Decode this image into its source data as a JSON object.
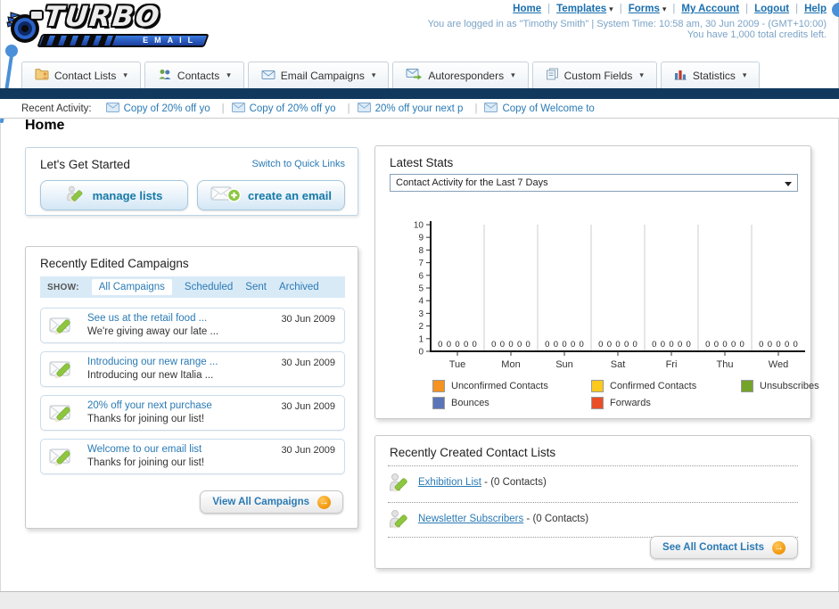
{
  "colors": {
    "accent_link": "#2A7AB5",
    "navy_bar": "#11395E",
    "annotation_dot": "#4A90D9",
    "button_text": "#1779A8",
    "filter_bar_bg": "#D9EAF7"
  },
  "logo": {
    "title": "TURBO",
    "subtitle": "EMAIL"
  },
  "header": {
    "links": [
      {
        "label": "Home",
        "has_dropdown": false
      },
      {
        "label": "Templates",
        "has_dropdown": true
      },
      {
        "label": "Forms",
        "has_dropdown": true
      },
      {
        "label": "My Account",
        "has_dropdown": false
      },
      {
        "label": "Logout",
        "has_dropdown": false
      },
      {
        "label": "Help",
        "has_dropdown": false
      }
    ],
    "login_line": "You are logged in as \"Timothy Smith\" | System Time: 10:58 am, 30 Jun 2009 - (GMT+10:00)",
    "credits_line": "You have 1,000 total credits left."
  },
  "nav": {
    "tabs": [
      {
        "label": "Contact Lists",
        "icon": "folder-contact-icon"
      },
      {
        "label": "Contacts",
        "icon": "contacts-icon"
      },
      {
        "label": "Email Campaigns",
        "icon": "envelope-icon"
      },
      {
        "label": "Autoresponders",
        "icon": "envelope-arrow-icon"
      },
      {
        "label": "Custom Fields",
        "icon": "pages-icon"
      },
      {
        "label": "Statistics",
        "icon": "bar-chart-icon"
      }
    ]
  },
  "recent_activity": {
    "label": "Recent Activity:",
    "items": [
      "Copy of 20% off yo",
      "Copy of 20% off yo",
      "20% off your next p",
      "Copy of Welcome to"
    ]
  },
  "page": {
    "title": "Home"
  },
  "get_started": {
    "title": "Let's Get Started",
    "switch_link": "Switch to Quick Links",
    "manage_lists_button": "manage lists",
    "create_email_button": "create an email"
  },
  "campaigns": {
    "title": "Recently Edited Campaigns",
    "show_label": "SHOW:",
    "filters": [
      "All Campaigns",
      "Scheduled",
      "Sent",
      "Archived"
    ],
    "active_filter": "All Campaigns",
    "items": [
      {
        "title": "See us at the retail food ...",
        "subtitle": "We're giving away our late ...",
        "date": "30 Jun 2009"
      },
      {
        "title": "Introducing our new range ...",
        "subtitle": "Introducing our new Italia ...",
        "date": "30 Jun 2009"
      },
      {
        "title": "20% off your next purchase",
        "subtitle": "Thanks for joining our list!",
        "date": "30 Jun 2009"
      },
      {
        "title": "Welcome to our email list",
        "subtitle": "Thanks for joining our list!",
        "date": "30 Jun 2009"
      }
    ],
    "view_all_button": "View All Campaigns"
  },
  "stats": {
    "title": "Latest Stats",
    "dropdown_value": "Contact Activity for the Last 7 Days"
  },
  "chart_data": {
    "type": "bar",
    "title": "Contact Activity for the Last 7 Days",
    "categories": [
      "Tue",
      "Mon",
      "Sun",
      "Sat",
      "Fri",
      "Thu",
      "Wed"
    ],
    "series": [
      {
        "name": "Unconfirmed Contacts",
        "color": "#F6921F",
        "values": [
          0,
          0,
          0,
          0,
          0,
          0,
          0
        ]
      },
      {
        "name": "Confirmed Contacts",
        "color": "#FDC91C",
        "values": [
          0,
          0,
          0,
          0,
          0,
          0,
          0
        ]
      },
      {
        "name": "Unsubscribes",
        "color": "#74A32A",
        "values": [
          0,
          0,
          0,
          0,
          0,
          0,
          0
        ]
      },
      {
        "name": "Bounces",
        "color": "#5A74B8",
        "values": [
          0,
          0,
          0,
          0,
          0,
          0,
          0
        ]
      },
      {
        "name": "Forwards",
        "color": "#E94E28",
        "values": [
          0,
          0,
          0,
          0,
          0,
          0,
          0
        ]
      }
    ],
    "ylim": [
      0,
      10
    ],
    "yticks": [
      0,
      1,
      2,
      3,
      4,
      5,
      6,
      7,
      8,
      9,
      10
    ],
    "grid": "vertical-only",
    "legend_position": "bottom",
    "value_labels": "zero shown per series per day above x-axis"
  },
  "contact_lists": {
    "title": "Recently Created Contact Lists",
    "items": [
      {
        "name": "Exhibition List",
        "detail": " - (0 Contacts)"
      },
      {
        "name": "Newsletter Subscribers",
        "detail": " - (0 Contacts)"
      }
    ],
    "see_all_button": "See All Contact Lists"
  }
}
